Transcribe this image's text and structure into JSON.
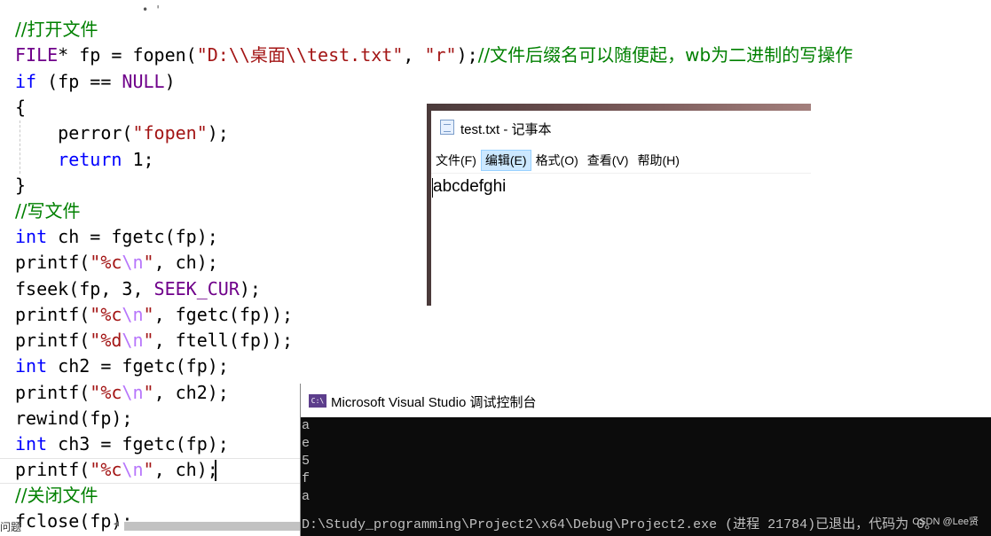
{
  "editor": {
    "lines": [
      {
        "parts": [
          {
            "t": "//打开文件",
            "c": "cm"
          }
        ]
      },
      {
        "parts": [
          {
            "t": "FILE",
            "c": "mc"
          },
          {
            "t": "* fp = fopen(",
            "c": ""
          },
          {
            "t": "\"D:\\\\桌面\\\\test.txt\"",
            "c": "st"
          },
          {
            "t": ", ",
            "c": ""
          },
          {
            "t": "\"r\"",
            "c": "st"
          },
          {
            "t": ");",
            "c": ""
          },
          {
            "t": "//文件后缀名可以随便起，wb为二进制的写操作",
            "c": "cm"
          }
        ]
      },
      {
        "parts": [
          {
            "t": "if",
            "c": "kw"
          },
          {
            "t": " (fp == ",
            "c": ""
          },
          {
            "t": "NULL",
            "c": "mc"
          },
          {
            "t": ")",
            "c": ""
          }
        ]
      },
      {
        "parts": [
          {
            "t": "{",
            "c": ""
          }
        ]
      },
      {
        "parts": [
          {
            "t": "    perror(",
            "c": ""
          },
          {
            "t": "\"fopen\"",
            "c": "st"
          },
          {
            "t": ");",
            "c": ""
          }
        ]
      },
      {
        "parts": [
          {
            "t": "    ",
            "c": ""
          },
          {
            "t": "return",
            "c": "kw"
          },
          {
            "t": " 1;",
            "c": ""
          }
        ]
      },
      {
        "parts": [
          {
            "t": "}",
            "c": ""
          }
        ]
      },
      {
        "parts": [
          {
            "t": "//写文件",
            "c": "cm"
          }
        ]
      },
      {
        "parts": [
          {
            "t": "int",
            "c": "kw"
          },
          {
            "t": " ch = fgetc(fp);",
            "c": ""
          }
        ]
      },
      {
        "parts": [
          {
            "t": "printf(",
            "c": ""
          },
          {
            "t": "\"%c",
            "c": "st"
          },
          {
            "t": "\\n",
            "c": "esc"
          },
          {
            "t": "\"",
            "c": "st"
          },
          {
            "t": ", ch);",
            "c": ""
          }
        ]
      },
      {
        "parts": [
          {
            "t": "fseek(fp, 3, ",
            "c": ""
          },
          {
            "t": "SEEK_CUR",
            "c": "mc"
          },
          {
            "t": ");",
            "c": ""
          }
        ]
      },
      {
        "parts": [
          {
            "t": "printf(",
            "c": ""
          },
          {
            "t": "\"%c",
            "c": "st"
          },
          {
            "t": "\\n",
            "c": "esc"
          },
          {
            "t": "\"",
            "c": "st"
          },
          {
            "t": ", fgetc(fp));",
            "c": ""
          }
        ]
      },
      {
        "parts": [
          {
            "t": "printf(",
            "c": ""
          },
          {
            "t": "\"%d",
            "c": "st"
          },
          {
            "t": "\\n",
            "c": "esc"
          },
          {
            "t": "\"",
            "c": "st"
          },
          {
            "t": ", ftell(fp));",
            "c": ""
          }
        ]
      },
      {
        "parts": [
          {
            "t": "int",
            "c": "kw"
          },
          {
            "t": " ch2 = fgetc(fp);",
            "c": ""
          }
        ]
      },
      {
        "parts": [
          {
            "t": "printf(",
            "c": ""
          },
          {
            "t": "\"%c",
            "c": "st"
          },
          {
            "t": "\\n",
            "c": "esc"
          },
          {
            "t": "\"",
            "c": "st"
          },
          {
            "t": ", ch2);",
            "c": ""
          }
        ]
      },
      {
        "parts": [
          {
            "t": "rewind(fp);",
            "c": ""
          }
        ]
      },
      {
        "parts": [
          {
            "t": "int",
            "c": "kw"
          },
          {
            "t": " ch3 = fgetc(fp);",
            "c": ""
          }
        ]
      },
      {
        "parts": [
          {
            "t": "printf(",
            "c": ""
          },
          {
            "t": "\"%c",
            "c": "st"
          },
          {
            "t": "\\n",
            "c": "esc"
          },
          {
            "t": "\"",
            "c": "st"
          },
          {
            "t": ", ch);",
            "c": ""
          }
        ]
      },
      {
        "parts": [
          {
            "t": "//关闭文件",
            "c": "cm"
          }
        ]
      },
      {
        "parts": [
          {
            "t": "fclose(fp);",
            "c": ""
          }
        ]
      }
    ],
    "error_list_label": "问题",
    "dots": "• '"
  },
  "notepad": {
    "title": "test.txt - 记事本",
    "menus": [
      "文件(F)",
      "编辑(E)",
      "格式(O)",
      "查看(V)",
      "帮助(H)"
    ],
    "active_menu": 1,
    "content": "abcdefghi"
  },
  "console": {
    "title": "Microsoft Visual Studio 调试控制台",
    "icon_text": "C:\\",
    "output_lines": [
      "a",
      "e",
      "5",
      "f",
      "a",
      "D:\\Study_programming\\Project2\\x64\\Debug\\Project2.exe (进程 21784)已退出，代码为 0。"
    ]
  },
  "watermark": "CSDN @Lee贤"
}
